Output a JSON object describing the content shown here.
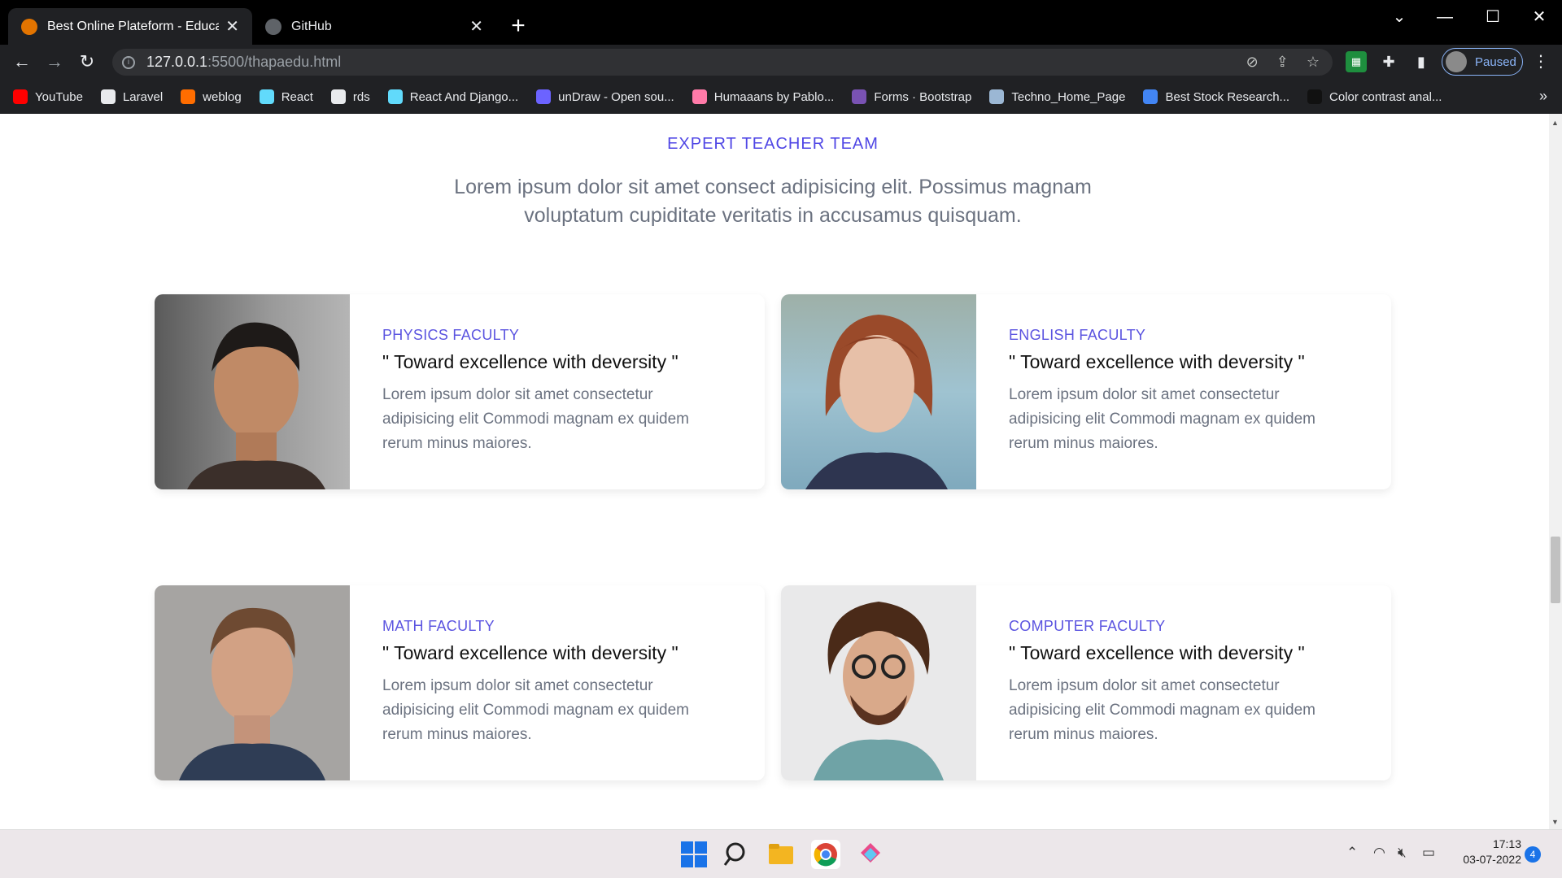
{
  "browser": {
    "tabs": [
      {
        "title": "Best Online Plateform - Education",
        "active": true
      },
      {
        "title": "GitHub",
        "active": false
      }
    ],
    "url_host": "127.0.0.1",
    "url_rest": ":5500/thapaedu.html",
    "profile_label": "Paused",
    "bookmarks": [
      {
        "label": "YouTube",
        "icon": "youtube-icon",
        "color": "#ff0000"
      },
      {
        "label": "Laravel",
        "icon": "globe-icon",
        "color": "#e8eaed"
      },
      {
        "label": "weblog",
        "icon": "weblog-icon",
        "color": "#ff6d00"
      },
      {
        "label": "React",
        "icon": "react-icon",
        "color": "#61dafb"
      },
      {
        "label": "rds",
        "icon": "globe-icon",
        "color": "#e8eaed"
      },
      {
        "label": "React And Django...",
        "icon": "react-icon",
        "color": "#61dafb"
      },
      {
        "label": "unDraw - Open sou...",
        "icon": "undraw-icon",
        "color": "#6c63ff"
      },
      {
        "label": "Humaaans by Pablo...",
        "icon": "humaaans-icon",
        "color": "#ff7aa8"
      },
      {
        "label": "Forms · Bootstrap",
        "icon": "bootstrap-icon",
        "color": "#7952b3"
      },
      {
        "label": "Techno_Home_Page",
        "icon": "techno-icon",
        "color": "#9bb7d4"
      },
      {
        "label": "Best Stock Research...",
        "icon": "stock-icon",
        "color": "#4285f4"
      },
      {
        "label": "Color contrast anal...",
        "icon": "contrast-icon",
        "color": "#111111"
      }
    ]
  },
  "section": {
    "kicker": "EXPERT TEACHER TEAM",
    "lead": "Lorem ipsum dolor sit amet consect adipisicing elit. Possimus magnam voluptatum cupiditate veritatis in accusamus quisquam."
  },
  "cards": [
    {
      "faculty": "PHYSICS FACULTY",
      "quote": "\" Toward excellence with deversity \"",
      "desc": "Lorem ipsum dolor sit amet consectetur adipisicing elit Commodi magnam ex quidem rerum minus maiores."
    },
    {
      "faculty": "ENGLISH FACULTY",
      "quote": "\" Toward excellence with deversity \"",
      "desc": "Lorem ipsum dolor sit amet consectetur adipisicing elit Commodi magnam ex quidem rerum minus maiores."
    },
    {
      "faculty": "MATH FACULTY",
      "quote": "\" Toward excellence with deversity \"",
      "desc": "Lorem ipsum dolor sit amet consectetur adipisicing elit Commodi magnam ex quidem rerum minus maiores."
    },
    {
      "faculty": "COMPUTER FACULTY",
      "quote": "\" Toward excellence with deversity \"",
      "desc": "Lorem ipsum dolor sit amet consectetur adipisicing elit Commodi magnam ex quidem rerum minus maiores."
    }
  ],
  "taskbar": {
    "time": "17:13",
    "date": "03-07-2022",
    "notifications": "4"
  },
  "colors": {
    "accent": "#4f46e5",
    "text_muted": "#6b7280"
  }
}
